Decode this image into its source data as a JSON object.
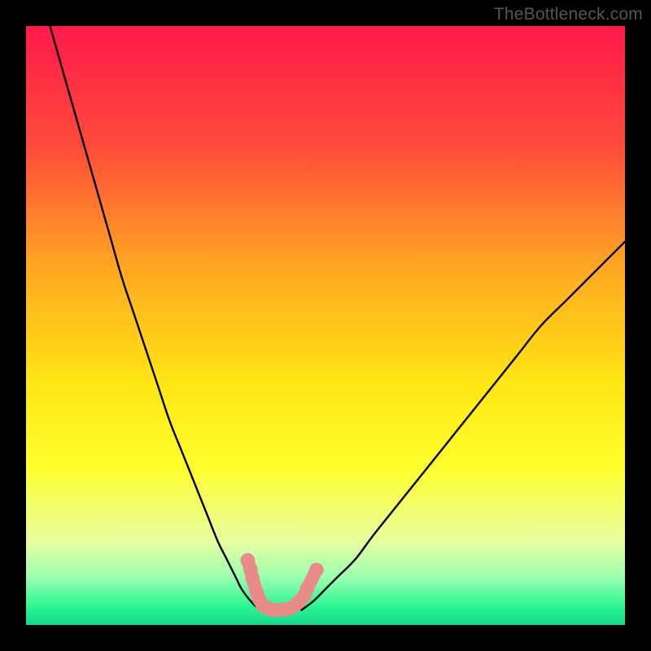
{
  "watermark": "TheBottleneck.com",
  "chart_data": {
    "type": "line",
    "title": "",
    "xlabel": "",
    "ylabel": "",
    "xlim": [
      0,
      100
    ],
    "ylim": [
      0,
      100
    ],
    "gradient_stops": [
      {
        "offset": 0.0,
        "color": "#ff1a4b"
      },
      {
        "offset": 0.2,
        "color": "#ff4b3a"
      },
      {
        "offset": 0.4,
        "color": "#ffa621"
      },
      {
        "offset": 0.6,
        "color": "#ffe714"
      },
      {
        "offset": 0.74,
        "color": "#ffff2f"
      },
      {
        "offset": 0.78,
        "color": "#f7ff55"
      },
      {
        "offset": 0.86,
        "color": "#e8ffa0"
      },
      {
        "offset": 0.92,
        "color": "#9cffb0"
      },
      {
        "offset": 0.97,
        "color": "#2bf593"
      },
      {
        "offset": 1.0,
        "color": "#14da8a"
      }
    ],
    "series": [
      {
        "name": "left-curve",
        "stroke": "#000000",
        "x": [
          4,
          6,
          8,
          10,
          12,
          14,
          16,
          18,
          20,
          22,
          24,
          26,
          28,
          30,
          32,
          33.5,
          35,
          36,
          37.5,
          39
        ],
        "y": [
          100,
          93,
          86,
          79,
          72,
          65,
          58,
          52,
          46,
          40,
          34,
          29,
          24,
          19,
          14,
          11,
          8,
          6,
          4,
          2.5
        ]
      },
      {
        "name": "right-curve",
        "stroke": "#000000",
        "x": [
          46,
          48,
          50,
          52,
          55,
          58,
          62,
          66,
          70,
          74,
          78,
          82,
          86,
          90,
          94,
          98,
          100
        ],
        "y": [
          2.5,
          4,
          6,
          8,
          11,
          15,
          20,
          25,
          30,
          35,
          40,
          45,
          50,
          54,
          58,
          62,
          64
        ]
      }
    ],
    "valley_markers": {
      "color": "#e98b88",
      "dot_radius": 1.2,
      "line_width": 2.2,
      "points": [
        {
          "x": 37.0,
          "y": 10.8
        },
        {
          "x": 37.5,
          "y": 9.2
        },
        {
          "x": 37.8,
          "y": 7.8
        },
        {
          "x": 38.5,
          "y": 5.5
        },
        {
          "x": 39.0,
          "y": 4.2
        },
        {
          "x": 39.5,
          "y": 3.3
        },
        {
          "x": 40.5,
          "y": 2.7
        },
        {
          "x": 41.5,
          "y": 2.5
        },
        {
          "x": 42.5,
          "y": 2.5
        },
        {
          "x": 43.5,
          "y": 2.6
        },
        {
          "x": 44.5,
          "y": 3.0
        },
        {
          "x": 45.5,
          "y": 3.8
        },
        {
          "x": 46.5,
          "y": 5.0
        },
        {
          "x": 47.0,
          "y": 6.2
        },
        {
          "x": 48.5,
          "y": 9.2
        }
      ]
    }
  }
}
